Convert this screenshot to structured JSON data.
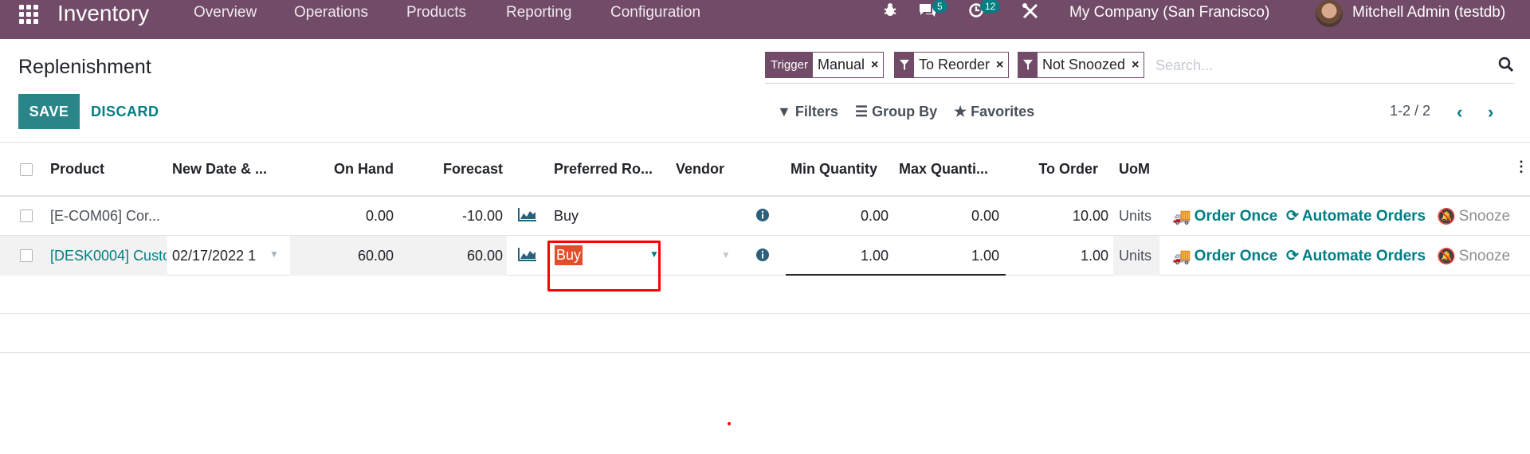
{
  "navbar": {
    "app_name": "Inventory",
    "menu": [
      "Overview",
      "Operations",
      "Products",
      "Reporting",
      "Configuration"
    ],
    "messages_count": "5",
    "activities_count": "12",
    "company": "My Company (San Francisco)",
    "user": "Mitchell Admin (testdb)"
  },
  "page": {
    "title": "Replenishment",
    "save_label": "SAVE",
    "discard_label": "DISCARD"
  },
  "search": {
    "facets": [
      {
        "label": "Trigger",
        "value": "Manual"
      },
      {
        "label": "",
        "value": "To Reorder"
      },
      {
        "label": "",
        "value": "Not Snoozed"
      }
    ],
    "placeholder": "Search..."
  },
  "controls": {
    "filters": "Filters",
    "group_by": "Group By",
    "favorites": "Favorites",
    "pager": "1-2 / 2"
  },
  "table": {
    "headers": {
      "product": "Product",
      "new_date": "New Date & ...",
      "on_hand": "On Hand",
      "forecast": "Forecast",
      "route": "Preferred Ro...",
      "vendor": "Vendor",
      "min_qty": "Min Quantity",
      "max_qty": "Max Quanti...",
      "to_order": "To Order",
      "uom": "UoM"
    },
    "rows": [
      {
        "product": "[E-COM06] Cor...",
        "new_date": "",
        "on_hand": "0.00",
        "forecast": "-10.00",
        "route": "Buy",
        "vendor": "",
        "min_qty": "0.00",
        "max_qty": "0.00",
        "to_order": "10.00",
        "uom": "Units"
      },
      {
        "product": "[DESK0004] Custo",
        "new_date": "02/17/2022 1",
        "on_hand": "60.00",
        "forecast": "60.00",
        "route": "Buy",
        "vendor": "",
        "min_qty": "1.00",
        "max_qty": "1.00",
        "to_order": "1.00",
        "uom": "Units"
      }
    ],
    "actions": {
      "order_once": "Order Once",
      "automate": "Automate Orders",
      "snooze": "Snooze"
    }
  },
  "colors": {
    "brand": "#714b67",
    "accent": "#017e84",
    "highlight": "#e24e2b",
    "annotation": "#ff0000"
  }
}
